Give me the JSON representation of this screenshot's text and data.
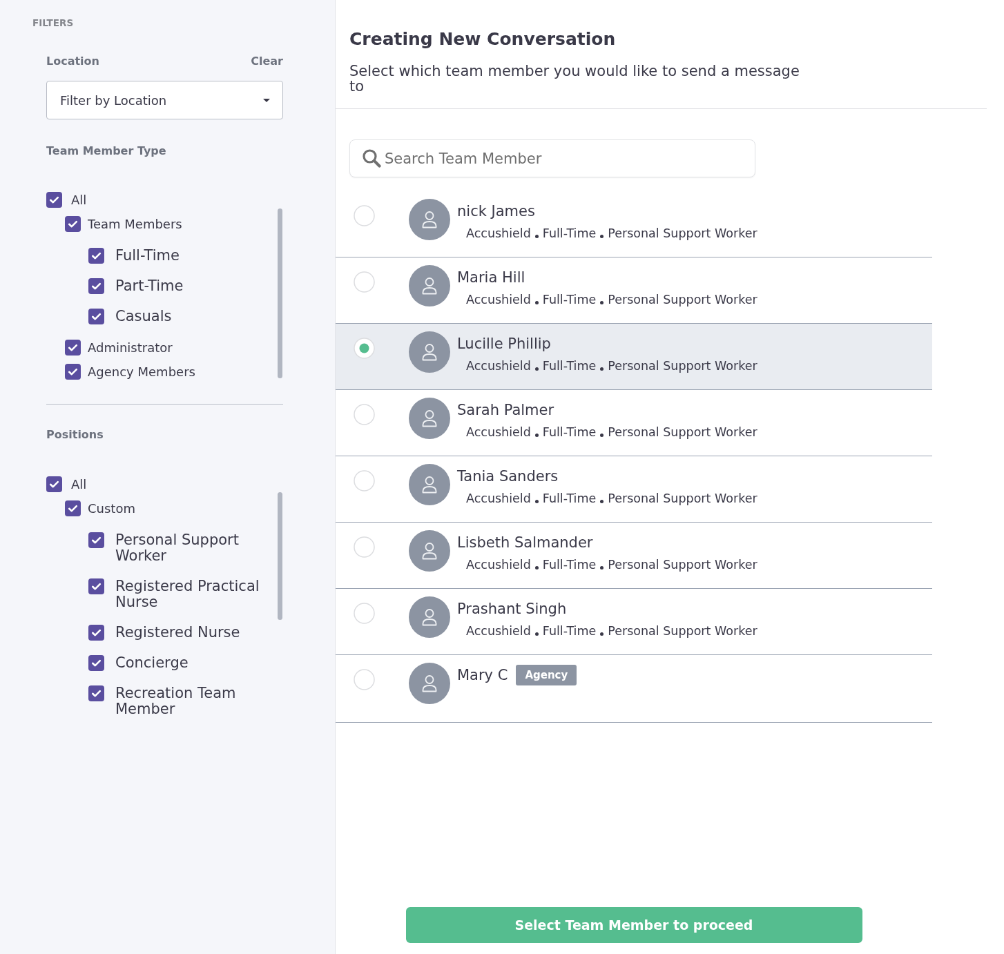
{
  "filters": {
    "title": "FILTERS",
    "location": {
      "label": "Location",
      "clear": "Clear",
      "dropdown": {
        "value": "Filter by Location"
      }
    },
    "team_member_type": {
      "label": "Team Member Type",
      "options": [
        {
          "label": "All",
          "checked": true,
          "children": [
            {
              "label": "Team Members",
              "checked": true,
              "children": [
                {
                  "label": "Full-Time",
                  "checked": true
                },
                {
                  "label": "Part-Time",
                  "checked": true
                },
                {
                  "label": "Casuals",
                  "checked": true
                }
              ]
            },
            {
              "label": "Administrator",
              "checked": true
            },
            {
              "label": "Agency Members",
              "checked": true
            }
          ]
        }
      ]
    },
    "positions": {
      "label": "Positions",
      "options": [
        {
          "label": "All",
          "checked": true,
          "children": [
            {
              "label": "Custom",
              "checked": true,
              "children": [
                {
                  "label": "Personal Support Worker",
                  "checked": true
                },
                {
                  "label": "Registered Practical Nurse",
                  "checked": true
                },
                {
                  "label": "Registered Nurse",
                  "checked": true
                },
                {
                  "label": "Concierge",
                  "checked": true
                },
                {
                  "label": "Recreation Team Member",
                  "checked": true
                }
              ]
            }
          ]
        }
      ]
    }
  },
  "conversation": {
    "title": "Creating New Conversation",
    "subtitle": "Select which team member you would like to send a message to",
    "search": {
      "placeholder": "Search Team Member"
    },
    "members": [
      {
        "name": "nick James",
        "organization": "Accushield",
        "employment_type": "Full-Time",
        "position": "Personal Support Worker",
        "selected": false
      },
      {
        "name": "Maria Hill",
        "organization": "Accushield",
        "employment_type": "Full-Time",
        "position": "Personal Support Worker",
        "selected": false
      },
      {
        "name": "Lucille Phillip",
        "organization": "Accushield",
        "employment_type": "Full-Time",
        "position": "Personal Support Worker",
        "selected": true
      },
      {
        "name": "Sarah Palmer",
        "organization": "Accushield",
        "employment_type": "Full-Time",
        "position": "Personal Support Worker",
        "selected": false
      },
      {
        "name": "Tania Sanders",
        "organization": "Accushield",
        "employment_type": "Full-Time",
        "position": "Personal Support Worker",
        "selected": false
      },
      {
        "name": "Lisbeth Salmander",
        "organization": "Accushield",
        "employment_type": "Full-Time",
        "position": "Personal Support Worker",
        "selected": false
      },
      {
        "name": "Prashant Singh",
        "organization": "Accushield",
        "employment_type": "Full-Time",
        "position": "Personal Support Worker",
        "selected": false
      },
      {
        "name": "Mary C",
        "badge": "Agency",
        "selected": false
      }
    ],
    "proceed_button": "Select Team Member to proceed"
  }
}
